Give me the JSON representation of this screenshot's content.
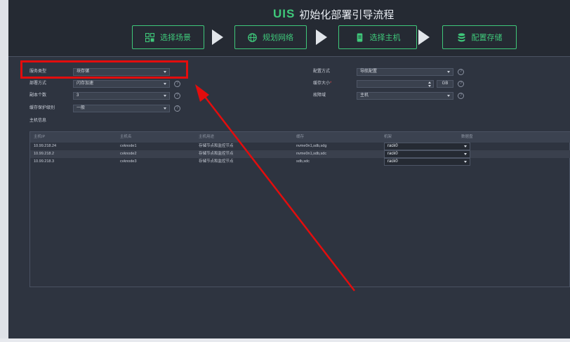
{
  "header": {
    "logo_mark": "UIS",
    "title": "初始化部署引导流程",
    "steps": [
      {
        "label": "选择场景",
        "icon": "scene-icon"
      },
      {
        "label": "规划网络",
        "icon": "network-globe-icon"
      },
      {
        "label": "选择主机",
        "icon": "server-icon"
      },
      {
        "label": "配置存储",
        "icon": "database-icon"
      }
    ]
  },
  "form": {
    "service_type": {
      "label": "服务类型",
      "value": "块存储"
    },
    "deploy_mode": {
      "label": "部署方式",
      "value": "闪存加速"
    },
    "replica_count": {
      "label": "副本个数",
      "value": "3"
    },
    "cache_protect": {
      "label": "缓存保护级别",
      "value": "一般"
    },
    "config_mode": {
      "label": "配置方式",
      "value": "导航配置"
    },
    "cache_size": {
      "label": "缓存大小",
      "required_mark": "*",
      "value": "",
      "unit": "GB"
    },
    "fault_domain": {
      "label": "故障域",
      "value": "主机"
    },
    "help_glyph": "?",
    "host_info_label": "主机信息"
  },
  "table": {
    "columns": [
      "主机IP",
      "主机名",
      "主机用途",
      "缓存",
      "机架",
      "数据盘"
    ],
    "rows": [
      {
        "ip": "10.99.218.24",
        "hostname": "cvknode1",
        "usage": "存储节点和监控节点",
        "cache": "nvme0n1,sdb,sdg",
        "rack": "rack0"
      },
      {
        "ip": "10.99.218.2",
        "hostname": "cvknode2",
        "usage": "存储节点和监控节点",
        "cache": "nvme0n1,sdb,sdc",
        "rack": "rack0"
      },
      {
        "ip": "10.99.218.3",
        "hostname": "cvknode3",
        "usage": "存储节点和监控节点",
        "cache": "sdb,sdc",
        "rack": "rack0"
      }
    ]
  },
  "colors": {
    "accent_green": "#3fc87a",
    "annotation_red": "#e30d0d",
    "panel_bg": "#2e3440",
    "header_bg": "#252a33"
  }
}
